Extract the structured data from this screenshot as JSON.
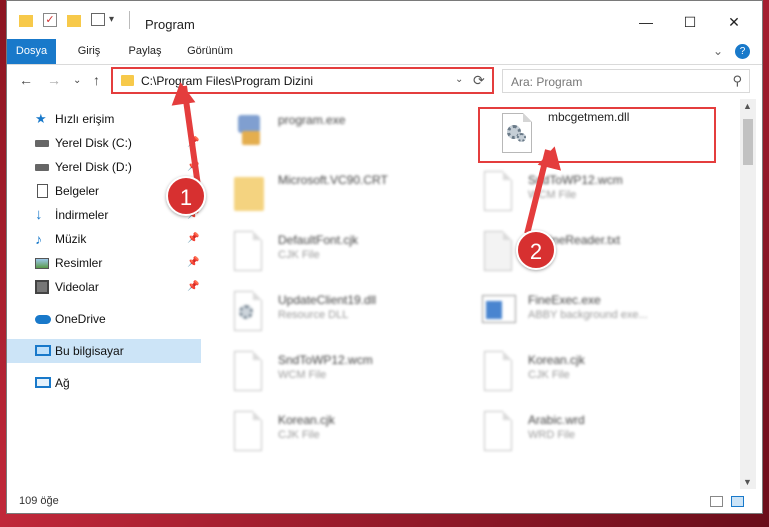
{
  "window": {
    "title": "Program",
    "min_glyph": "—",
    "max_glyph": "☐",
    "close_glyph": "✕"
  },
  "ribbon": {
    "tabs": [
      "Dosya",
      "Giriş",
      "Paylaş",
      "Görünüm"
    ],
    "expand_glyph": "⌄",
    "help_glyph": "?"
  },
  "nav": {
    "back": "←",
    "forward": "→",
    "recent": "⌄",
    "up": "↑"
  },
  "address": {
    "path": "C:\\Program Files\\Program Dizini",
    "dropdown": "⌄",
    "refresh": "⟳"
  },
  "search": {
    "placeholder": "Ara: Program",
    "icon": "⚲"
  },
  "sidebar": {
    "items": [
      {
        "label": "Hızlı erişim",
        "icon": "star-icon",
        "pinned": false
      },
      {
        "label": "Yerel Disk (C:)",
        "icon": "drive-icon",
        "pinned": true
      },
      {
        "label": "Yerel Disk (D:)",
        "icon": "drive-icon",
        "pinned": true
      },
      {
        "label": "Belgeler",
        "icon": "documents-icon",
        "pinned": true
      },
      {
        "label": "İndirmeler",
        "icon": "download-icon",
        "pinned": true
      },
      {
        "label": "Müzik",
        "icon": "music-icon",
        "pinned": true
      },
      {
        "label": "Resimler",
        "icon": "pictures-icon",
        "pinned": true
      },
      {
        "label": "Videolar",
        "icon": "videos-icon",
        "pinned": true
      },
      {
        "label": "OneDrive",
        "icon": "cloud-icon",
        "pinned": false
      },
      {
        "label": "Bu bilgisayar",
        "icon": "computer-icon",
        "pinned": false,
        "selected": true
      },
      {
        "label": "Ağ",
        "icon": "network-icon",
        "pinned": false
      }
    ],
    "pin_glyph": "📌"
  },
  "files": [
    {
      "name": "program.exe",
      "type": "",
      "icon": "exe-icon",
      "blurred": true
    },
    {
      "name": "mbcgetmem.dll",
      "type": "",
      "icon": "dll-gear-icon",
      "blurred": false,
      "highlighted": true
    },
    {
      "name": "Microsoft.VC90.CRT",
      "type": "",
      "icon": "folder-icon",
      "blurred": true
    },
    {
      "name": "SndToWP12.wcm",
      "type": "WCM File",
      "icon": "file-icon",
      "blurred": true
    },
    {
      "name": "DefaultFont.cjk",
      "type": "CJK File",
      "icon": "file-icon",
      "blurred": true
    },
    {
      "name": "EngineReader.txt",
      "type": "",
      "icon": "text-file-icon",
      "blurred": true
    },
    {
      "name": "UpdateClient19.dll",
      "type": "Resource DLL",
      "icon": "dll-gear-icon",
      "blurred": true
    },
    {
      "name": "FineExec.exe",
      "type": "ABBY background exe...",
      "icon": "app-window-icon",
      "blurred": true
    },
    {
      "name": "SndToWP12.wcm",
      "type": "WCM File",
      "icon": "file-icon",
      "blurred": true
    },
    {
      "name": "Korean.cjk",
      "type": "CJK File",
      "icon": "file-icon",
      "blurred": true
    },
    {
      "name": "Korean.cjk",
      "type": "CJK File",
      "icon": "file-icon",
      "blurred": true
    },
    {
      "name": "Arabic.wrd",
      "type": "WRD File",
      "icon": "file-icon",
      "blurred": true
    }
  ],
  "status": {
    "count": "109 öğe"
  },
  "annotations": {
    "badge1": "1",
    "badge2": "2",
    "color": "#e43d3d"
  },
  "colors": {
    "accent": "#1979ca",
    "selection": "#cce4f7",
    "folder": "#f7c94a",
    "highlight": "#e43d3d"
  }
}
